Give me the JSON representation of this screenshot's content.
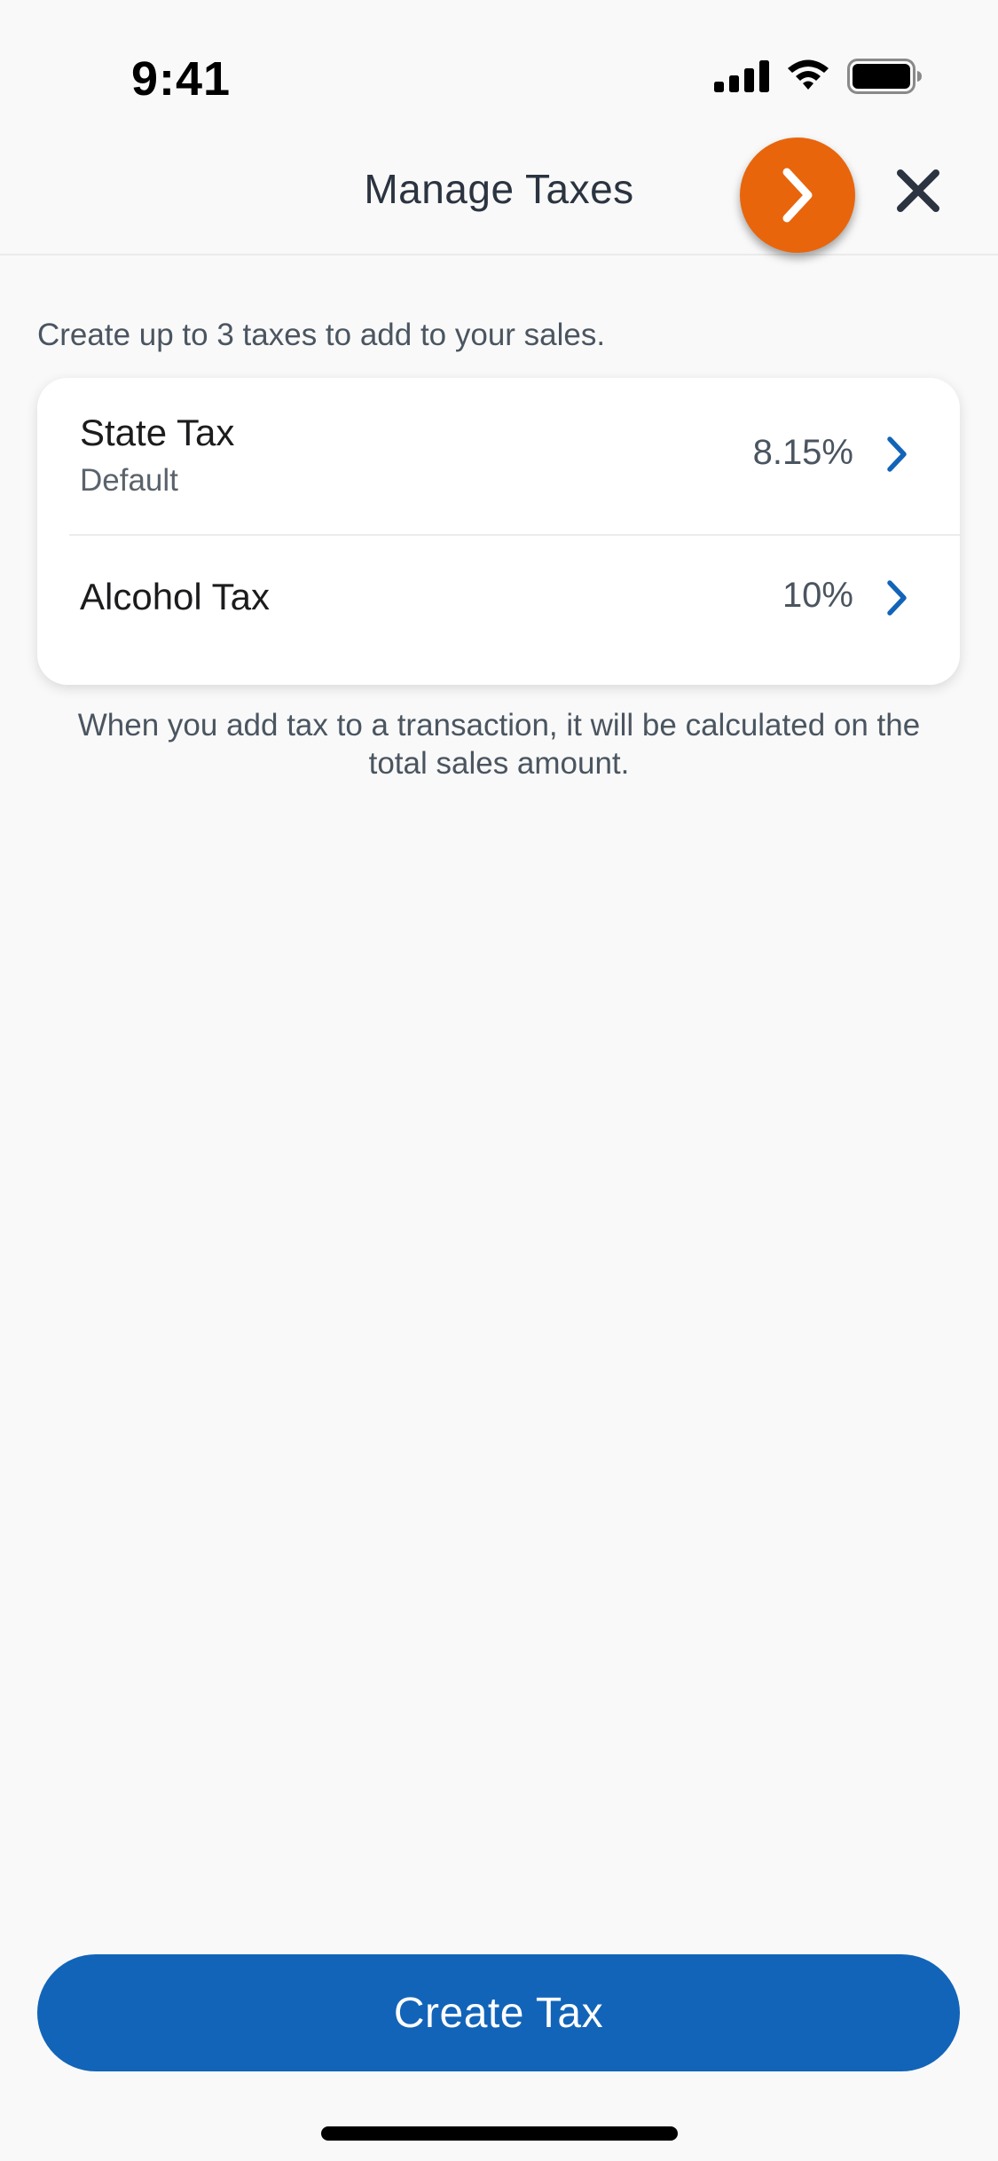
{
  "status_bar": {
    "time": "9:41"
  },
  "header": {
    "title": "Manage Taxes"
  },
  "intro_text": "Create up to 3 taxes to add to your sales.",
  "taxes": [
    {
      "name": "State Tax",
      "subtitle": "Default",
      "rate": "8.15%"
    },
    {
      "name": "Alcohol Tax",
      "subtitle": "",
      "rate": "10%"
    }
  ],
  "footnote": "When you add tax to a transaction, it will be calculated on the total sales amount.",
  "create_button_label": "Create Tax",
  "colors": {
    "accent_blue": "#1264b8",
    "next_orange": "#e8650c",
    "background": "#f9f9f9"
  },
  "icons": [
    "signal-icon",
    "wifi-icon",
    "battery-icon",
    "chevron-right-icon",
    "close-icon"
  ]
}
